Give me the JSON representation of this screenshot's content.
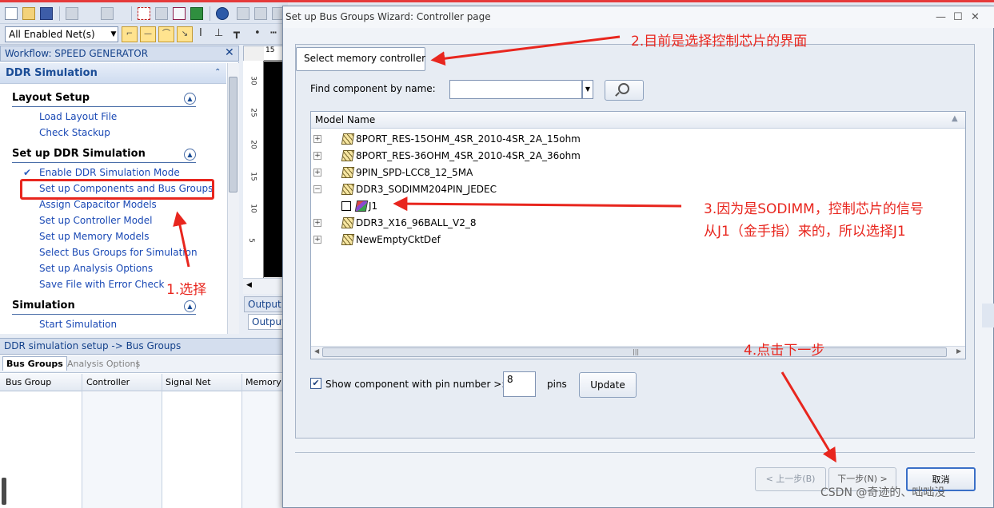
{
  "toolbar": {
    "net_filter_value": "All Enabled Net(s)"
  },
  "workflow": {
    "title": "Workflow: SPEED GENERATOR",
    "close_glyph": "✕",
    "group_title": "DDR Simulation",
    "collapse_glyph": "⌃",
    "sections": [
      {
        "title": "Layout Setup",
        "items": [
          "Load Layout File",
          "Check Stackup"
        ]
      },
      {
        "title": "Set up DDR Simulation",
        "items": [
          "Enable DDR Simulation Mode",
          "Set up Components and Bus Groups",
          "Assign Capacitor Models",
          "Set up Controller Model",
          "Set up Memory Models",
          "Select Bus Groups for Simulation",
          "Set up Analysis Options",
          "Save File with Error Check"
        ]
      },
      {
        "title": "Simulation",
        "items": [
          "Start Simulation"
        ]
      }
    ],
    "check_glyph": "✔",
    "up_glyph": "▲"
  },
  "canvas": {
    "ruler_top": "15",
    "ruler_ticks": [
      "30",
      "25",
      "20",
      "15",
      "10",
      "5"
    ],
    "output_tabs": [
      "Output",
      "Output"
    ]
  },
  "bottom_panel": {
    "header": "DDR simulation setup -> Bus Groups",
    "tabs": [
      "Bus Groups",
      "Analysis Options"
    ],
    "tab_separator": "|",
    "columns": [
      "Bus Group",
      "Controller",
      "Signal Net",
      "Memory"
    ]
  },
  "dialog": {
    "title": "Set up Bus Groups Wizard: Controller page",
    "controls": [
      "—",
      "☐",
      "✕"
    ],
    "section_label": "Select memory controller",
    "find_label": "Find component by name:",
    "find_value": "",
    "list_header": "Model Name",
    "sort_glyph": "▲",
    "models": [
      {
        "name": "8PORT_RES-15OHM_4SR_2010-4SR_2A_15ohm",
        "expander": "+"
      },
      {
        "name": "8PORT_RES-36OHM_4SR_2010-4SR_2A_36ohm",
        "expander": "+"
      },
      {
        "name": "9PIN_SPD-LCC8_12_5MA",
        "expander": "+"
      },
      {
        "name": "DDR3_SODIMM204PIN_JEDEC",
        "expander": "−"
      },
      {
        "name": "DDR3_X16_96BALL_V2_8",
        "expander": "+"
      },
      {
        "name": "NewEmptyCktDef",
        "expander": "+"
      }
    ],
    "child_item": "J1",
    "show_pins_label": "Show component with pin number >:",
    "pins_value": "8",
    "pins_unit": "pins",
    "update_label": "Update",
    "back_label": "< 上一步(B)",
    "next_label": "下一步(N) >",
    "cancel_label": "取消",
    "check_glyph": "✔",
    "scroll_left": "◀",
    "scroll_right": "▶",
    "scroll_grip": "|||"
  },
  "annotations": {
    "step1": "1.选择",
    "step2": "2.目前是选择控制芯片的界面",
    "step3_line1": "3.因为是SODIMM，控制芯片的信号",
    "step3_line2": "从J1（金手指）来的，所以选择J1",
    "step4": "4.点击下一步",
    "color": "#e8261e"
  },
  "watermark": "CSDN @奇迹的、咄咄没",
  "colors": {
    "link": "#1a49b5",
    "accent": "#3a6fc7",
    "panel_header": "#d4deee"
  }
}
